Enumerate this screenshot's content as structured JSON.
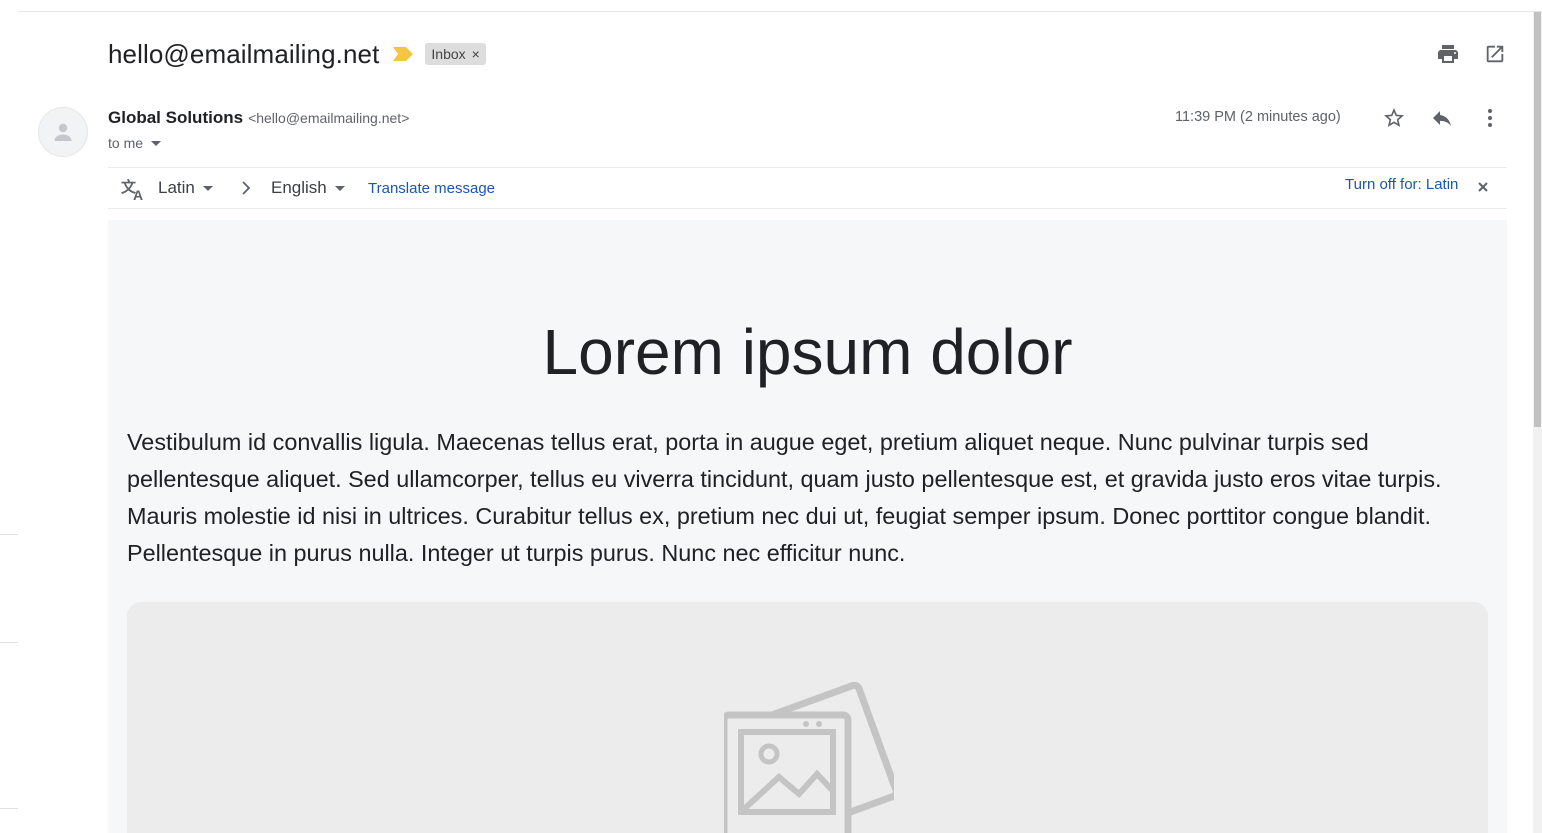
{
  "subject": {
    "title": "hello@emailmailing.net",
    "label": "Inbox",
    "label_remove": "×"
  },
  "toolbar": {
    "icons": [
      "print-icon",
      "open-in-new-window-icon"
    ]
  },
  "message": {
    "sender_name": "Global Solutions",
    "sender_email": "<hello@emailmailing.net>",
    "recipient": "to me",
    "timestamp": "11:39 PM (2 minutes ago)",
    "icons": [
      "star-icon",
      "reply-icon",
      "more-vertical-icon"
    ]
  },
  "translate": {
    "source_lang": "Latin",
    "target_lang": "English",
    "translate_link": "Translate message",
    "turn_off": "Turn off for: Latin"
  },
  "body": {
    "headline": "Lorem ipsum dolor",
    "paragraph": "Vestibulum id convallis ligula. Maecenas tellus erat, porta in augue eget, pretium aliquet neque. Nunc pulvinar turpis sed pellentesque aliquet. Sed ullamcorper, tellus eu viverra tincidunt, quam justo pellentesque est, et gravida justo eros vitae turpis. Mauris molestie id nisi in ultrices. Curabitur tellus ex, pretium nec dui ut, feugiat semper ipsum. Donec porttitor congue blandit. Pellentesque in purus nulla. Integer ut turpis purus. Nunc nec efficitur nunc.",
    "image_icon": "image-placeholder-icon"
  },
  "colors": {
    "link": "#1a56b8",
    "importance_marker": "#f4c542",
    "label_chip": "#dddddd",
    "body_background": "#f6f7f8"
  }
}
